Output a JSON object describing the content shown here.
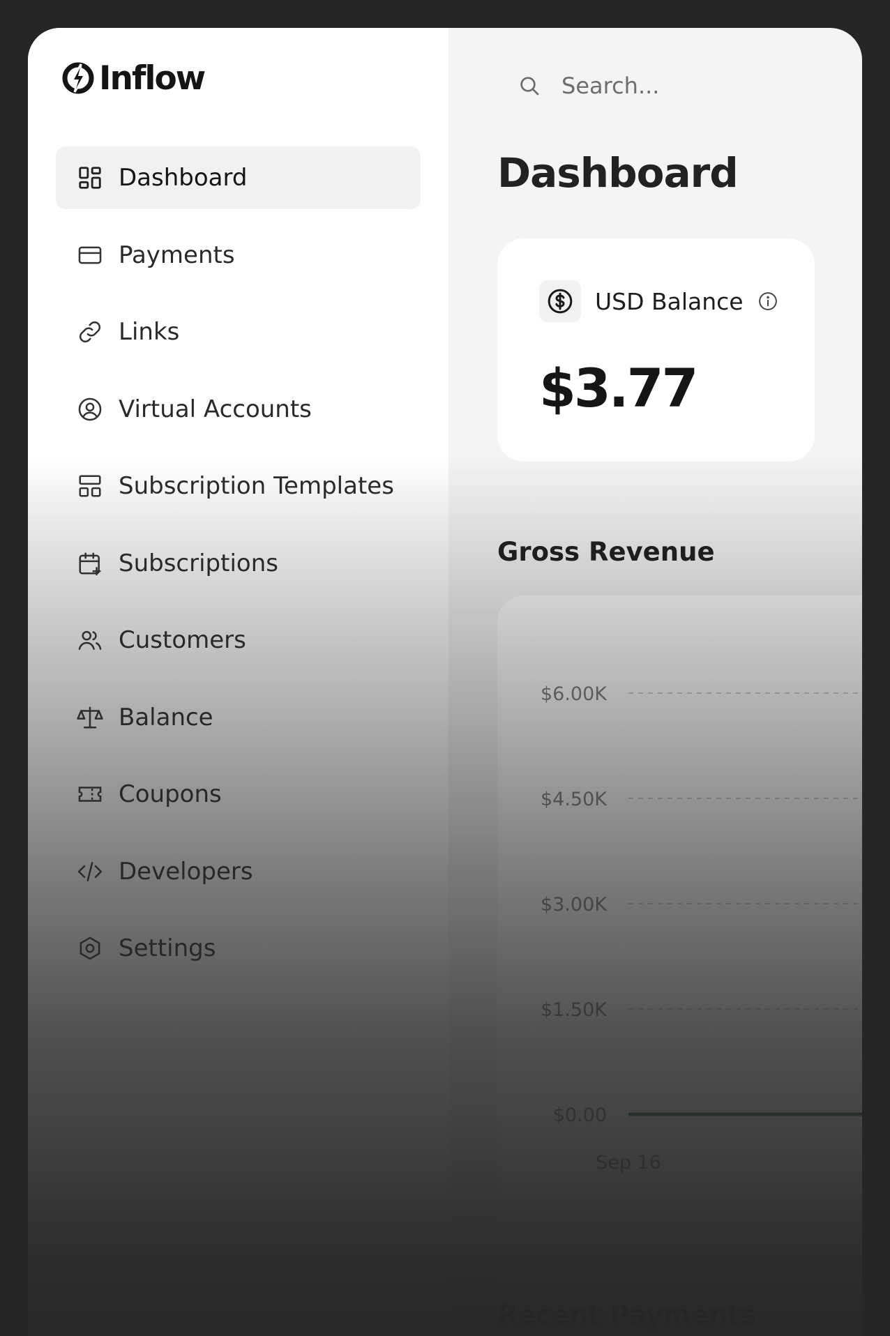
{
  "app": {
    "brand": "Inflow",
    "accent_color": "#2e6b3a"
  },
  "sidebar": {
    "items": [
      {
        "label": "Dashboard",
        "icon": "dashboard-grid-icon",
        "active": true
      },
      {
        "label": "Payments",
        "icon": "credit-card-icon",
        "active": false
      },
      {
        "label": "Links",
        "icon": "link-icon",
        "active": false
      },
      {
        "label": "Virtual Accounts",
        "icon": "user-circle-icon",
        "active": false
      },
      {
        "label": "Subscription Templates",
        "icon": "template-layout-icon",
        "active": false
      },
      {
        "label": "Subscriptions",
        "icon": "calendar-plus-icon",
        "active": false
      },
      {
        "label": "Customers",
        "icon": "users-icon",
        "active": false
      },
      {
        "label": "Balance",
        "icon": "scale-icon",
        "active": false
      },
      {
        "label": "Coupons",
        "icon": "ticket-icon",
        "active": false
      },
      {
        "label": "Developers",
        "icon": "code-icon",
        "active": false
      },
      {
        "label": "Settings",
        "icon": "gear-hexagon-icon",
        "active": false
      }
    ]
  },
  "header": {
    "search_placeholder": "Search..."
  },
  "main": {
    "title": "Dashboard",
    "balance_card": {
      "label": "USD Balance",
      "amount": "$3.77",
      "icon": "dollar-coin-icon",
      "info_icon": "info-icon"
    },
    "gross_revenue_title": "Gross Revenue",
    "recent_payments_title": "Recent Payments"
  },
  "chart_data": {
    "type": "line",
    "title": "Gross Revenue",
    "x": [
      "Sep 16"
    ],
    "series": [
      {
        "values": [
          0
        ]
      }
    ],
    "y_tick_labels": [
      "$6.00K",
      "$4.50K",
      "$3.00K",
      "$1.50K",
      "$0.00"
    ],
    "y_ticks": [
      6000,
      4500,
      3000,
      1500,
      0
    ],
    "ylim": [
      0,
      6000
    ],
    "grid": true,
    "line_color": "#2e6b3a"
  }
}
